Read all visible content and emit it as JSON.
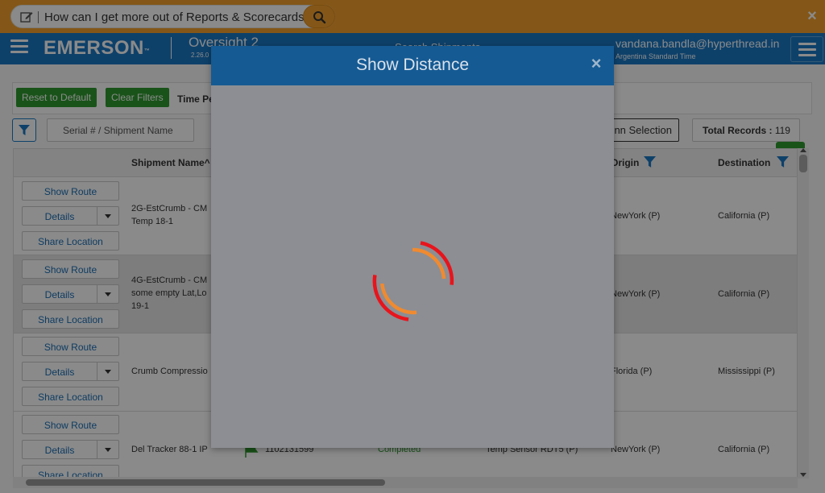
{
  "help_bar": {
    "question": "How can I get more out of Reports & Scorecards?",
    "close": "×"
  },
  "header": {
    "brand": "EMERSON",
    "brand_tm": "™",
    "app_name": "Oversight 2",
    "app_version": "2.26.0",
    "page_title": "Search Shipments",
    "user_email": "vandana.bandla@hyperthread.in",
    "user_timezone": "Argentina Standard Time"
  },
  "toolbar": {
    "reset_label": "Reset to Default",
    "clear_label": "Clear Filters",
    "time_period_label": "Time Pe",
    "serial_placeholder": "Serial # / Shipment Name",
    "column_selection_label": "nn Selection",
    "total_records_label": "Total Records :",
    "total_records_value": "119"
  },
  "grid": {
    "headers": {
      "shipment_name": "Shipment Name^",
      "origin": "Origin",
      "destination": "Destination"
    },
    "actions": {
      "show_route": "Show Route",
      "details": "Details",
      "share_location": "Share Location"
    },
    "rows": [
      {
        "name_line1": "2G-EstCrumb - CM",
        "name_line2": "Temp 18-1",
        "name_line3": "",
        "origin": "NewYork (P)",
        "destination": "California (P)"
      },
      {
        "name_line1": "4G-EstCrumb - CM",
        "name_line2": "some empty Lat,Lo",
        "name_line3": "19-1",
        "origin": "NewYork (P)",
        "destination": "California (P)"
      },
      {
        "name_line1": "Crumb Compressio",
        "name_line2": "",
        "name_line3": "",
        "origin": "Florida (P)",
        "destination": "Mississippi (P)"
      },
      {
        "name_line1": "Del Tracker 88-1 IP",
        "name_line2": "",
        "name_line3": "",
        "serial": "1102131599",
        "status": "Completed",
        "sensor": "Temp Sensor RDT5 (P)",
        "origin": "NewYork (P)",
        "destination": "California (P)"
      }
    ]
  },
  "modal": {
    "title": "Show Distance",
    "close": "×"
  },
  "colors": {
    "brand_blue": "#1a79c5",
    "help_orange": "#f4a12e",
    "action_green": "#2f9a2f",
    "spinner_red": "#e8141c",
    "spinner_orange": "#f08a30"
  }
}
